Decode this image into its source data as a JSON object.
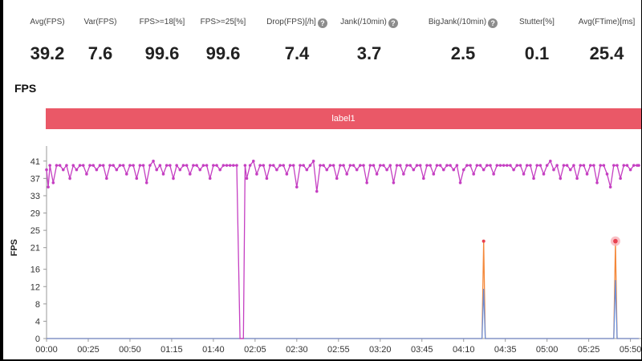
{
  "metrics": [
    {
      "label": "Avg(FPS)",
      "value": "39.2",
      "help": false
    },
    {
      "label": "Var(FPS)",
      "value": "7.6",
      "help": false
    },
    {
      "label": "FPS>=18[%]",
      "value": "99.6",
      "help": false
    },
    {
      "label": "FPS>=25[%]",
      "value": "99.6",
      "help": false
    },
    {
      "label": "Drop(FPS)[/h]",
      "value": "7.4",
      "help": true
    },
    {
      "label": "Jank(/10min)",
      "value": "3.7",
      "help": true
    },
    {
      "label": "BigJank(/10min)",
      "value": "2.5",
      "help": true
    },
    {
      "label": "Stutter[%]",
      "value": "0.1",
      "help": false
    },
    {
      "label": "Avg(FTime)[ms]",
      "value": "25.4",
      "help": false
    }
  ],
  "section_title": "FPS",
  "label_bar": "label1",
  "help_glyph": "?",
  "colors": {
    "fps_line": "#c53fc2",
    "jank": "#f4883a",
    "bigjank": "#6b8fd8",
    "bigjank_marker": "#e8404f",
    "label_bar": "#ea5867"
  },
  "chart_data": {
    "type": "line",
    "title": "",
    "xlabel": "",
    "ylabel": "FPS",
    "y_ticks": [
      0,
      4,
      8,
      12,
      16,
      21,
      25,
      29,
      33,
      37,
      41
    ],
    "ylim": [
      0,
      43
    ],
    "x_ticks": [
      "00:00",
      "00:25",
      "00:50",
      "01:15",
      "01:40",
      "02:05",
      "02:30",
      "02:55",
      "03:20",
      "03:45",
      "04:10",
      "04:35",
      "05:00",
      "05:25",
      "05:50"
    ],
    "xlim_seconds": [
      0,
      355
    ],
    "series": [
      {
        "name": "",
        "sample_interval_s": 2,
        "points": [
          [
            0,
            39
          ],
          [
            1,
            35
          ],
          [
            2,
            40
          ],
          [
            4,
            36
          ],
          [
            6,
            40
          ],
          [
            8,
            40
          ],
          [
            10,
            39
          ],
          [
            12,
            40
          ],
          [
            14,
            37
          ],
          [
            16,
            40
          ],
          [
            18,
            39
          ],
          [
            20,
            40
          ],
          [
            22,
            40
          ],
          [
            24,
            38
          ],
          [
            26,
            40
          ],
          [
            28,
            40
          ],
          [
            30,
            39
          ],
          [
            32,
            40
          ],
          [
            34,
            40
          ],
          [
            36,
            37
          ],
          [
            38,
            40
          ],
          [
            40,
            40
          ],
          [
            42,
            39
          ],
          [
            44,
            40
          ],
          [
            46,
            40
          ],
          [
            48,
            38
          ],
          [
            50,
            40
          ],
          [
            52,
            40
          ],
          [
            54,
            37
          ],
          [
            56,
            40
          ],
          [
            58,
            40
          ],
          [
            60,
            36
          ],
          [
            62,
            40
          ],
          [
            64,
            41
          ],
          [
            66,
            39
          ],
          [
            68,
            40
          ],
          [
            70,
            38
          ],
          [
            72,
            40
          ],
          [
            74,
            40
          ],
          [
            76,
            37
          ],
          [
            78,
            40
          ],
          [
            80,
            39
          ],
          [
            82,
            40
          ],
          [
            84,
            40
          ],
          [
            86,
            38
          ],
          [
            88,
            40
          ],
          [
            90,
            40
          ],
          [
            92,
            39
          ],
          [
            94,
            40
          ],
          [
            96,
            40
          ],
          [
            98,
            37
          ],
          [
            100,
            40
          ],
          [
            102,
            40
          ],
          [
            104,
            39
          ],
          [
            106,
            40
          ],
          [
            108,
            40
          ],
          [
            110,
            40
          ],
          [
            112,
            40
          ],
          [
            114,
            40
          ],
          [
            116,
            0
          ],
          [
            117,
            0
          ],
          [
            118,
            0
          ],
          [
            119,
            40
          ],
          [
            120,
            37
          ],
          [
            122,
            40
          ],
          [
            124,
            41
          ],
          [
            126,
            38
          ],
          [
            128,
            40
          ],
          [
            130,
            40
          ],
          [
            132,
            37
          ],
          [
            134,
            40
          ],
          [
            136,
            40
          ],
          [
            138,
            39
          ],
          [
            140,
            40
          ],
          [
            142,
            40
          ],
          [
            144,
            38
          ],
          [
            146,
            40
          ],
          [
            148,
            40
          ],
          [
            150,
            35
          ],
          [
            152,
            40
          ],
          [
            154,
            40
          ],
          [
            156,
            39
          ],
          [
            158,
            40
          ],
          [
            160,
            41
          ],
          [
            162,
            34
          ],
          [
            164,
            40
          ],
          [
            166,
            40
          ],
          [
            168,
            39
          ],
          [
            170,
            40
          ],
          [
            172,
            40
          ],
          [
            174,
            37
          ],
          [
            176,
            40
          ],
          [
            178,
            40
          ],
          [
            180,
            38
          ],
          [
            182,
            40
          ],
          [
            184,
            40
          ],
          [
            186,
            39
          ],
          [
            188,
            40
          ],
          [
            190,
            40
          ],
          [
            192,
            36
          ],
          [
            194,
            40
          ],
          [
            196,
            40
          ],
          [
            198,
            38
          ],
          [
            200,
            40
          ],
          [
            202,
            40
          ],
          [
            204,
            39
          ],
          [
            206,
            40
          ],
          [
            208,
            36
          ],
          [
            210,
            40
          ],
          [
            212,
            40
          ],
          [
            214,
            38
          ],
          [
            216,
            40
          ],
          [
            218,
            40
          ],
          [
            220,
            39
          ],
          [
            222,
            40
          ],
          [
            224,
            40
          ],
          [
            226,
            37
          ],
          [
            228,
            40
          ],
          [
            230,
            40
          ],
          [
            232,
            38
          ],
          [
            234,
            40
          ],
          [
            236,
            40
          ],
          [
            238,
            39
          ],
          [
            240,
            40
          ],
          [
            242,
            40
          ],
          [
            244,
            39
          ],
          [
            246,
            40
          ],
          [
            248,
            36
          ],
          [
            250,
            39
          ],
          [
            252,
            40
          ],
          [
            254,
            40
          ],
          [
            256,
            38
          ],
          [
            258,
            40
          ],
          [
            260,
            40
          ],
          [
            262,
            39
          ],
          [
            264,
            40
          ],
          [
            266,
            40
          ],
          [
            268,
            38
          ],
          [
            270,
            40
          ],
          [
            272,
            40
          ],
          [
            274,
            40
          ],
          [
            276,
            40
          ],
          [
            278,
            40
          ],
          [
            280,
            39
          ],
          [
            282,
            40
          ],
          [
            284,
            40
          ],
          [
            286,
            38
          ],
          [
            288,
            40
          ],
          [
            290,
            40
          ],
          [
            292,
            37
          ],
          [
            294,
            40
          ],
          [
            296,
            40
          ],
          [
            298,
            38
          ],
          [
            300,
            40
          ],
          [
            302,
            41
          ],
          [
            304,
            39
          ],
          [
            306,
            40
          ],
          [
            308,
            37
          ],
          [
            310,
            40
          ],
          [
            312,
            40
          ],
          [
            314,
            39
          ],
          [
            316,
            40
          ],
          [
            318,
            37
          ],
          [
            320,
            40
          ],
          [
            322,
            40
          ],
          [
            324,
            38
          ],
          [
            326,
            40
          ],
          [
            328,
            40
          ],
          [
            330,
            36
          ],
          [
            332,
            40
          ],
          [
            334,
            40
          ],
          [
            336,
            38
          ],
          [
            338,
            35
          ],
          [
            340,
            40
          ],
          [
            342,
            40
          ],
          [
            344,
            37
          ],
          [
            346,
            40
          ],
          [
            348,
            40
          ],
          [
            350,
            39
          ],
          [
            352,
            40
          ],
          [
            354,
            40
          ],
          [
            355,
            40
          ]
        ]
      },
      {
        "name": "",
        "points": [
          [
            0,
            0
          ],
          [
            261,
            0
          ],
          [
            262,
            22.5
          ],
          [
            263,
            0
          ],
          [
            340,
            0
          ],
          [
            341,
            22.5
          ],
          [
            342,
            0
          ],
          [
            355,
            0
          ]
        ],
        "markers": [
          [
            262,
            22.5
          ],
          [
            341,
            22.5
          ]
        ]
      },
      {
        "name": "",
        "points": [
          [
            0,
            0
          ],
          [
            261,
            0
          ],
          [
            262,
            11.5
          ],
          [
            263,
            0
          ],
          [
            340,
            0
          ],
          [
            341,
            13.5
          ],
          [
            342,
            0
          ],
          [
            355,
            0
          ]
        ]
      }
    ]
  }
}
